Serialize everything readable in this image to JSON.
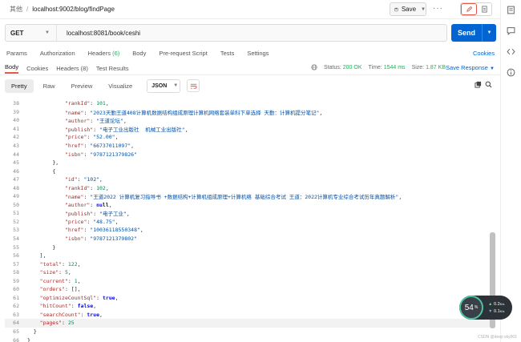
{
  "breadcrumb": {
    "parent": "其他",
    "separator": "/",
    "current": "localhost:9002/blog/findPage"
  },
  "toolbar": {
    "save_label": "Save"
  },
  "request": {
    "method": "GET",
    "url": "localhost:8081/book/ceshi",
    "send_label": "Send"
  },
  "request_tabs": [
    {
      "label": "Params",
      "count": ""
    },
    {
      "label": "Authorization",
      "count": ""
    },
    {
      "label": "Headers",
      "count": "(6)"
    },
    {
      "label": "Body",
      "count": ""
    },
    {
      "label": "Pre-request Script",
      "count": ""
    },
    {
      "label": "Tests",
      "count": ""
    },
    {
      "label": "Settings",
      "count": ""
    }
  ],
  "cookies_label": "Cookies",
  "response_tabs": [
    {
      "label": "Body"
    },
    {
      "label": "Cookies"
    },
    {
      "label": "Headers (8)"
    },
    {
      "label": "Test Results"
    }
  ],
  "response_status": {
    "status_label": "Status:",
    "status": "200 OK",
    "time_label": "Time:",
    "time": "1544 ms",
    "size_label": "Size:",
    "size": "1.87 KB",
    "save_response": "Save Response"
  },
  "view_tabs": [
    "Pretty",
    "Raw",
    "Preview",
    "Visualize"
  ],
  "format": "JSON",
  "code_lines": [
    {
      "n": "38",
      "segs": [
        [
          "pad",
          "            "
        ],
        [
          "key",
          "\"rankId\""
        ],
        [
          "pun",
          ": "
        ],
        [
          "num",
          "101"
        ],
        [
          "pun",
          ","
        ]
      ]
    },
    {
      "n": "39",
      "segs": [
        [
          "pad",
          "            "
        ],
        [
          "key",
          "\"name\""
        ],
        [
          "pun",
          ": "
        ],
        [
          "str",
          "\"2023天勤王道408计算机数据结构组成原理计算机网络套装单科下单选择 天勤：计算机提分笔记\""
        ],
        [
          "pun",
          ","
        ]
      ]
    },
    {
      "n": "40",
      "segs": [
        [
          "pad",
          "            "
        ],
        [
          "key",
          "\"author\""
        ],
        [
          "pun",
          ": "
        ],
        [
          "str",
          "\"王道论坛\""
        ],
        [
          "pun",
          ","
        ]
      ]
    },
    {
      "n": "41",
      "segs": [
        [
          "pad",
          "            "
        ],
        [
          "key",
          "\"publish\""
        ],
        [
          "pun",
          ": "
        ],
        [
          "str",
          "\"电子工业出版社  机械工业出版社\""
        ],
        [
          "pun",
          ","
        ]
      ]
    },
    {
      "n": "42",
      "segs": [
        [
          "pad",
          "            "
        ],
        [
          "key",
          "\"price\""
        ],
        [
          "pun",
          ": "
        ],
        [
          "str",
          "\"52.00\""
        ],
        [
          "pun",
          ","
        ]
      ]
    },
    {
      "n": "43",
      "segs": [
        [
          "pad",
          "            "
        ],
        [
          "key",
          "\"href\""
        ],
        [
          "pun",
          ": "
        ],
        [
          "str",
          "\"66737011097\""
        ],
        [
          "pun",
          ","
        ]
      ]
    },
    {
      "n": "44",
      "segs": [
        [
          "pad",
          "            "
        ],
        [
          "key",
          "\"isbn\""
        ],
        [
          "pun",
          ": "
        ],
        [
          "str",
          "\"9787121379826\""
        ]
      ]
    },
    {
      "n": "45",
      "segs": [
        [
          "pad",
          "        "
        ],
        [
          "pun",
          "},"
        ]
      ]
    },
    {
      "n": "46",
      "segs": [
        [
          "pad",
          "        "
        ],
        [
          "pun",
          "{"
        ]
      ]
    },
    {
      "n": "47",
      "segs": [
        [
          "pad",
          "            "
        ],
        [
          "key",
          "\"id\""
        ],
        [
          "pun",
          ": "
        ],
        [
          "str",
          "\"102\""
        ],
        [
          "pun",
          ","
        ]
      ]
    },
    {
      "n": "48",
      "segs": [
        [
          "pad",
          "            "
        ],
        [
          "key",
          "\"rankId\""
        ],
        [
          "pun",
          ": "
        ],
        [
          "num",
          "102"
        ],
        [
          "pun",
          ","
        ]
      ]
    },
    {
      "n": "49",
      "segs": [
        [
          "pad",
          "            "
        ],
        [
          "key",
          "\"name\""
        ],
        [
          "pun",
          ": "
        ],
        [
          "str",
          "\"王道2022 计算机复习指导书 +数据结构+计算机组成原理+计算机络 基础综合考试 王道：2022计算机专业综合考试历年真题解析\""
        ],
        [
          "pun",
          ","
        ]
      ]
    },
    {
      "n": "50",
      "segs": [
        [
          "pad",
          "            "
        ],
        [
          "key",
          "\"author\""
        ],
        [
          "pun",
          ": "
        ],
        [
          "kw",
          "null"
        ],
        [
          "pun",
          ","
        ]
      ]
    },
    {
      "n": "51",
      "segs": [
        [
          "pad",
          "            "
        ],
        [
          "key",
          "\"publish\""
        ],
        [
          "pun",
          ": "
        ],
        [
          "str",
          "\"电子工业\""
        ],
        [
          "pun",
          ","
        ]
      ]
    },
    {
      "n": "52",
      "segs": [
        [
          "pad",
          "            "
        ],
        [
          "key",
          "\"price\""
        ],
        [
          "pun",
          ": "
        ],
        [
          "str",
          "\"48.75\""
        ],
        [
          "pun",
          ","
        ]
      ]
    },
    {
      "n": "53",
      "segs": [
        [
          "pad",
          "            "
        ],
        [
          "key",
          "\"href\""
        ],
        [
          "pun",
          ": "
        ],
        [
          "str",
          "\"10036118550348\""
        ],
        [
          "pun",
          ","
        ]
      ]
    },
    {
      "n": "54",
      "segs": [
        [
          "pad",
          "            "
        ],
        [
          "key",
          "\"isbn\""
        ],
        [
          "pun",
          ": "
        ],
        [
          "str",
          "\"9787121379802\""
        ]
      ]
    },
    {
      "n": "55",
      "segs": [
        [
          "pad",
          "        "
        ],
        [
          "pun",
          "}"
        ]
      ]
    },
    {
      "n": "56",
      "segs": [
        [
          "pad",
          "    "
        ],
        [
          "pun",
          "],"
        ]
      ]
    },
    {
      "n": "57",
      "segs": [
        [
          "pad",
          "    "
        ],
        [
          "key",
          "\"total\""
        ],
        [
          "pun",
          ": "
        ],
        [
          "num",
          "122"
        ],
        [
          "pun",
          ","
        ]
      ]
    },
    {
      "n": "58",
      "segs": [
        [
          "pad",
          "    "
        ],
        [
          "key",
          "\"size\""
        ],
        [
          "pun",
          ": "
        ],
        [
          "num",
          "5"
        ],
        [
          "pun",
          ","
        ]
      ]
    },
    {
      "n": "59",
      "segs": [
        [
          "pad",
          "    "
        ],
        [
          "key",
          "\"current\""
        ],
        [
          "pun",
          ": "
        ],
        [
          "num",
          "1"
        ],
        [
          "pun",
          ","
        ]
      ]
    },
    {
      "n": "60",
      "segs": [
        [
          "pad",
          "    "
        ],
        [
          "key",
          "\"orders\""
        ],
        [
          "pun",
          ": [],"
        ]
      ]
    },
    {
      "n": "61",
      "segs": [
        [
          "pad",
          "    "
        ],
        [
          "key",
          "\"optimizeCountSql\""
        ],
        [
          "pun",
          ": "
        ],
        [
          "kw",
          "true"
        ],
        [
          "pun",
          ","
        ]
      ]
    },
    {
      "n": "62",
      "segs": [
        [
          "pad",
          "    "
        ],
        [
          "key",
          "\"hitCount\""
        ],
        [
          "pun",
          ": "
        ],
        [
          "kw",
          "false"
        ],
        [
          "pun",
          ","
        ]
      ]
    },
    {
      "n": "63",
      "segs": [
        [
          "pad",
          "    "
        ],
        [
          "key",
          "\"searchCount\""
        ],
        [
          "pun",
          ": "
        ],
        [
          "kw",
          "true"
        ],
        [
          "pun",
          ","
        ]
      ]
    },
    {
      "n": "64",
      "segs": [
        [
          "pad",
          "    "
        ],
        [
          "key",
          "\"pages\""
        ],
        [
          "pun",
          ": "
        ],
        [
          "num",
          "25"
        ]
      ]
    },
    {
      "n": "65",
      "segs": [
        [
          "pad",
          "  "
        ],
        [
          "pun",
          "}"
        ]
      ]
    },
    {
      "n": "66",
      "segs": [
        [
          "pun",
          "}"
        ]
      ]
    }
  ],
  "net_widget": {
    "percent": "54",
    "unit": "%",
    "up": "0.2",
    "up_unit": "K/s",
    "down": "0.1",
    "down_unit": "K/s"
  },
  "watermark": "CSDN @deep sky001"
}
